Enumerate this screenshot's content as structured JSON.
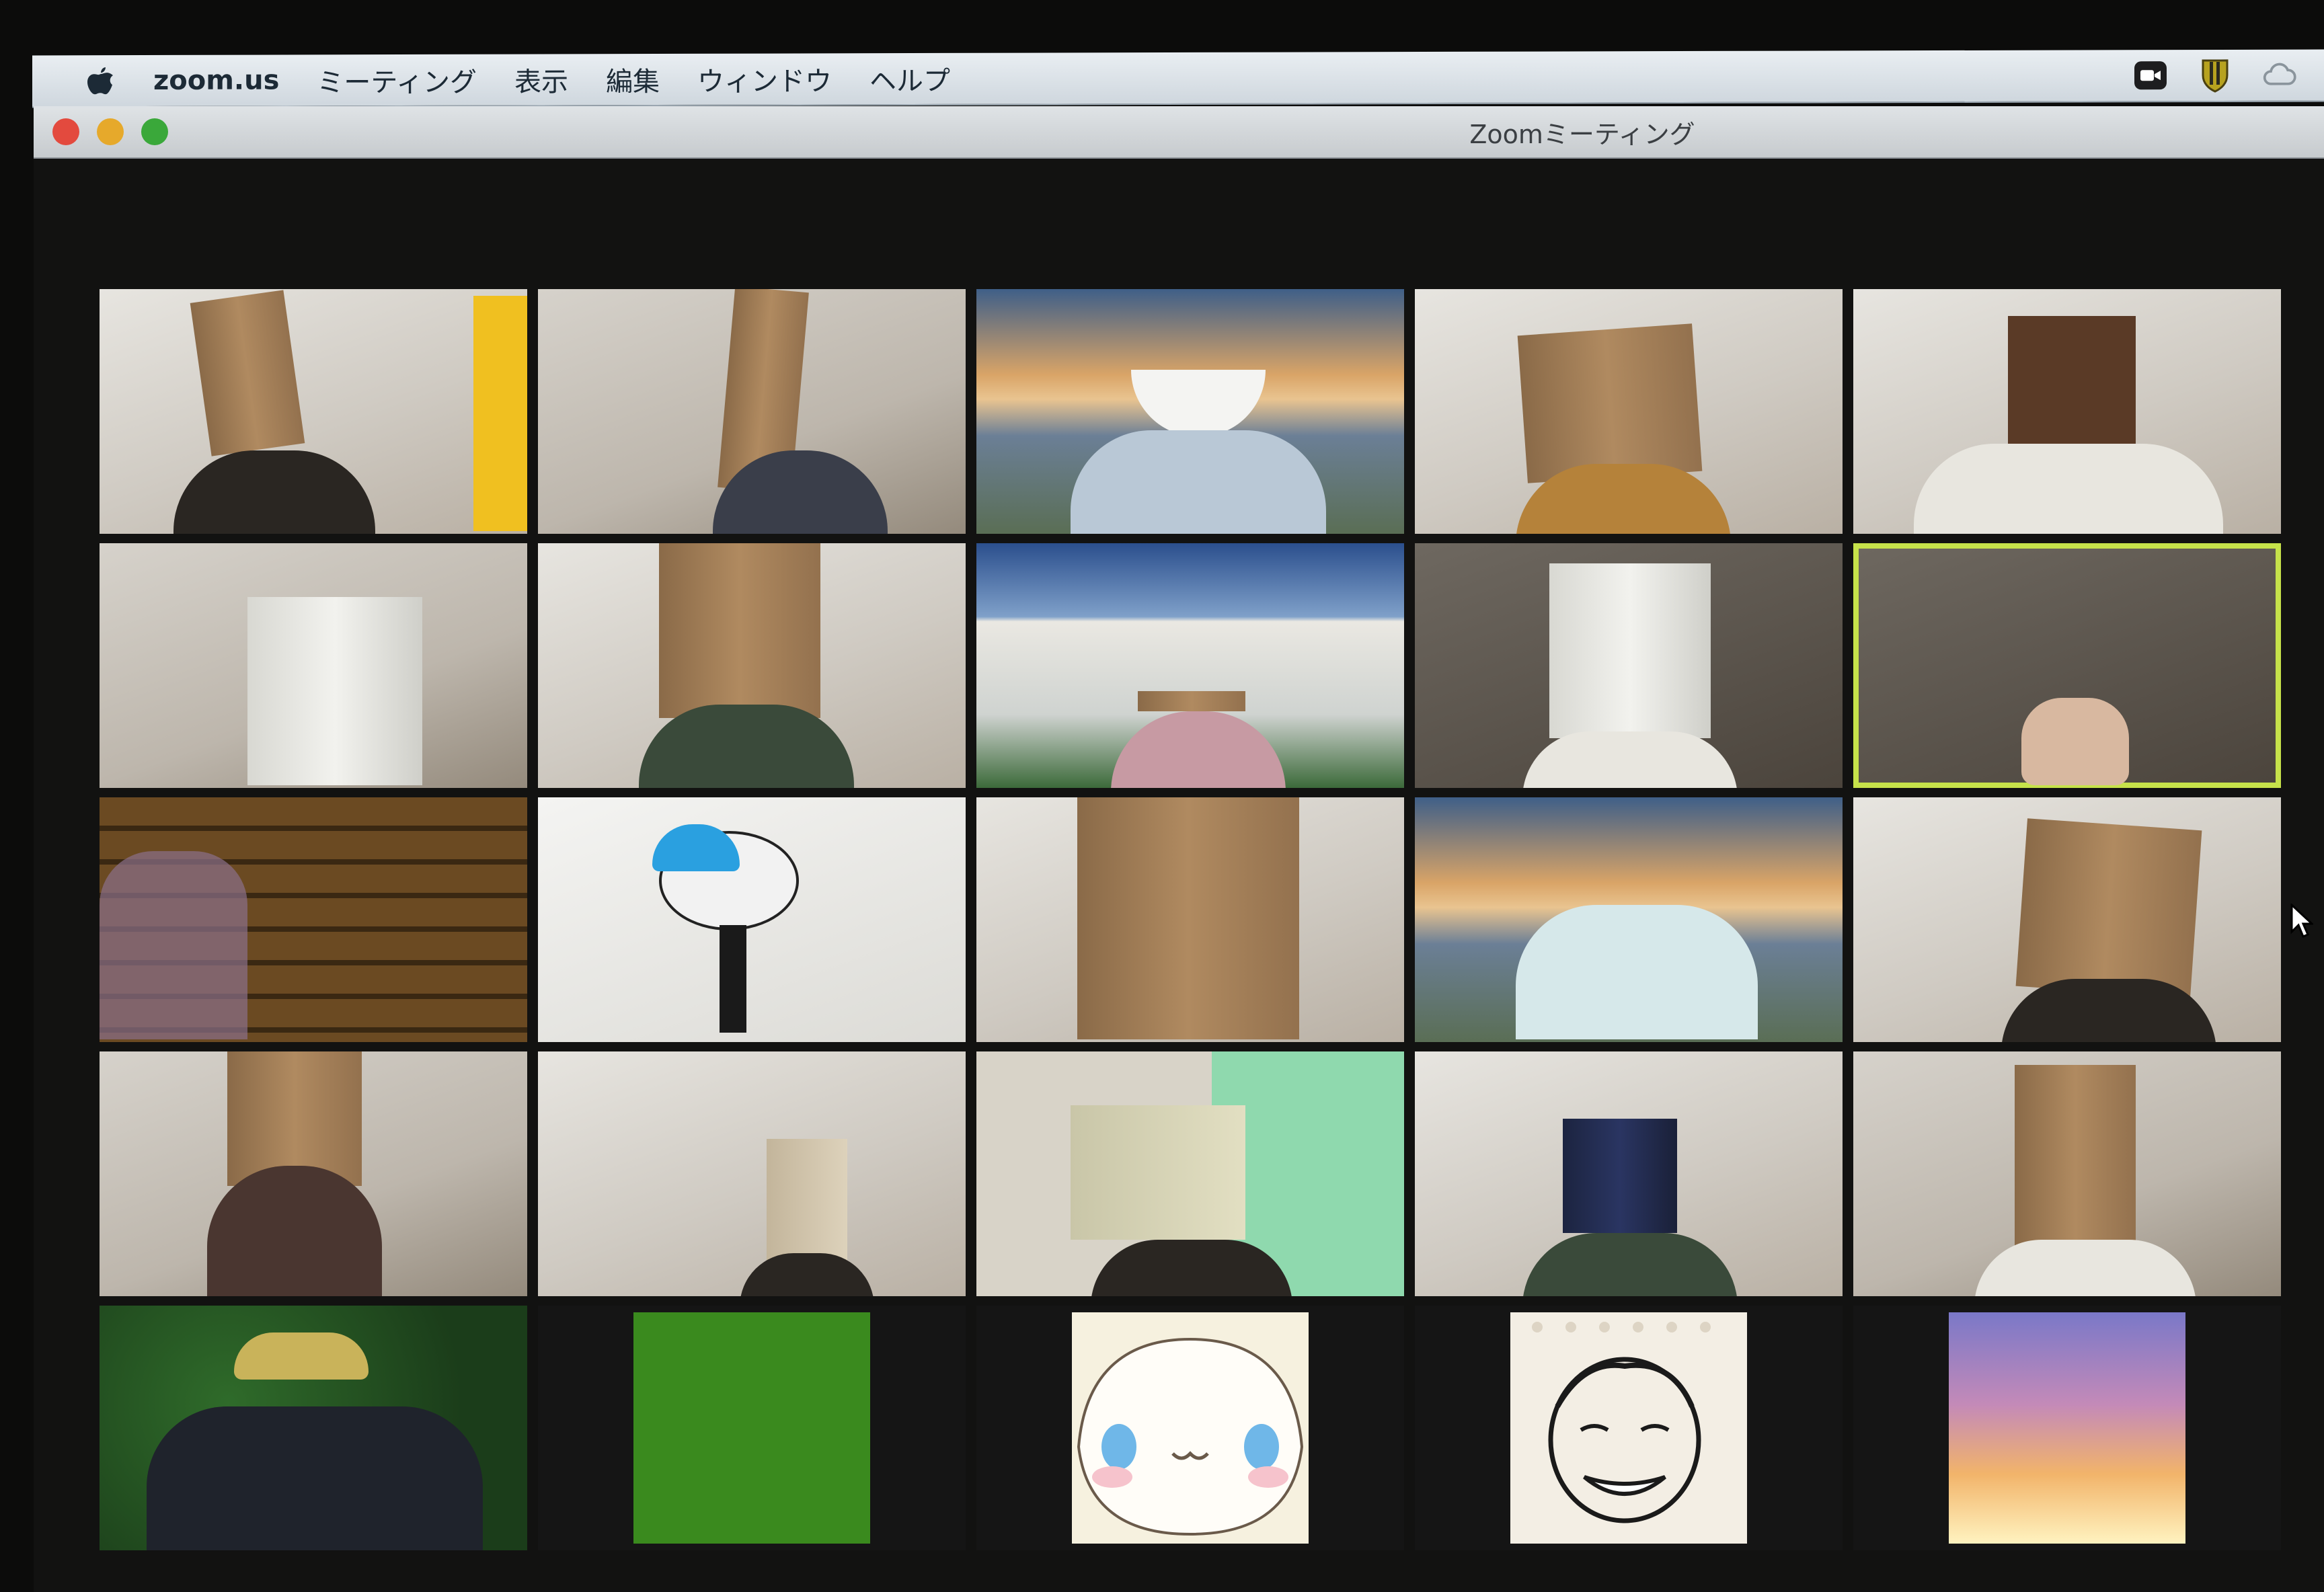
{
  "menubar": {
    "apple_icon": "apple-icon",
    "app_name": "zoom.us",
    "items": [
      "ミーティング",
      "表示",
      "編集",
      "ウィンドウ",
      "ヘルプ"
    ],
    "tray_icons": [
      "zoom-camera-icon",
      "shield-icon",
      "creative-cloud-icon"
    ]
  },
  "window": {
    "title": "Zoomミーティング",
    "controls": [
      "close",
      "minimize",
      "zoom"
    ],
    "colors": {
      "close": "#e34a3e",
      "minimize": "#e6a92b",
      "zoom": "#3aa83a"
    }
  },
  "meeting": {
    "layout": "gallery",
    "columns": 5,
    "rows": 5,
    "active_speaker_color": "#c6e24a",
    "tiles": [
      {
        "row": 1,
        "col": 1,
        "type": "video",
        "scene": "paper-bag-room-poster"
      },
      {
        "row": 1,
        "col": 2,
        "type": "video",
        "scene": "paper-bag-room"
      },
      {
        "row": 1,
        "col": 3,
        "type": "video",
        "scene": "bowl-bridge-background"
      },
      {
        "row": 1,
        "col": 4,
        "type": "video",
        "scene": "paper-bag-room"
      },
      {
        "row": 1,
        "col": 5,
        "type": "video",
        "scene": "paper-bag-room"
      },
      {
        "row": 2,
        "col": 1,
        "type": "video",
        "scene": "white-bag-room"
      },
      {
        "row": 2,
        "col": 2,
        "type": "video",
        "scene": "paper-bag-bedroom"
      },
      {
        "row": 2,
        "col": 3,
        "type": "video",
        "scene": "building-background"
      },
      {
        "row": 2,
        "col": 4,
        "type": "video",
        "scene": "printed-bag-room"
      },
      {
        "row": 2,
        "col": 5,
        "type": "video",
        "scene": "dark-room",
        "active_speaker": true
      },
      {
        "row": 3,
        "col": 1,
        "type": "video",
        "scene": "library-background"
      },
      {
        "row": 3,
        "col": 2,
        "type": "video",
        "scene": "mascot-hall"
      },
      {
        "row": 3,
        "col": 3,
        "type": "video",
        "scene": "paper-bag-closeup"
      },
      {
        "row": 3,
        "col": 4,
        "type": "video",
        "scene": "bridge-background"
      },
      {
        "row": 3,
        "col": 5,
        "type": "video",
        "scene": "paper-bag-room"
      },
      {
        "row": 4,
        "col": 1,
        "type": "video",
        "scene": "paper-bag-room"
      },
      {
        "row": 4,
        "col": 2,
        "type": "video",
        "scene": "paper-bag-room"
      },
      {
        "row": 4,
        "col": 3,
        "type": "video",
        "scene": "white-bag-curtain"
      },
      {
        "row": 4,
        "col": 4,
        "type": "video",
        "scene": "navy-bag-room"
      },
      {
        "row": 4,
        "col": 5,
        "type": "video",
        "scene": "paper-bag-room"
      },
      {
        "row": 5,
        "col": 1,
        "type": "video",
        "scene": "hat-forest"
      },
      {
        "row": 5,
        "col": 2,
        "type": "avatar",
        "image": "green-square",
        "color": "#3a8a1e"
      },
      {
        "row": 5,
        "col": 3,
        "type": "avatar",
        "image": "cinnamoroll-face"
      },
      {
        "row": 5,
        "col": 4,
        "type": "avatar",
        "image": "face-drawing"
      },
      {
        "row": 5,
        "col": 5,
        "type": "avatar",
        "image": "anime-still"
      }
    ]
  },
  "cursor": "arrow-cursor-icon"
}
